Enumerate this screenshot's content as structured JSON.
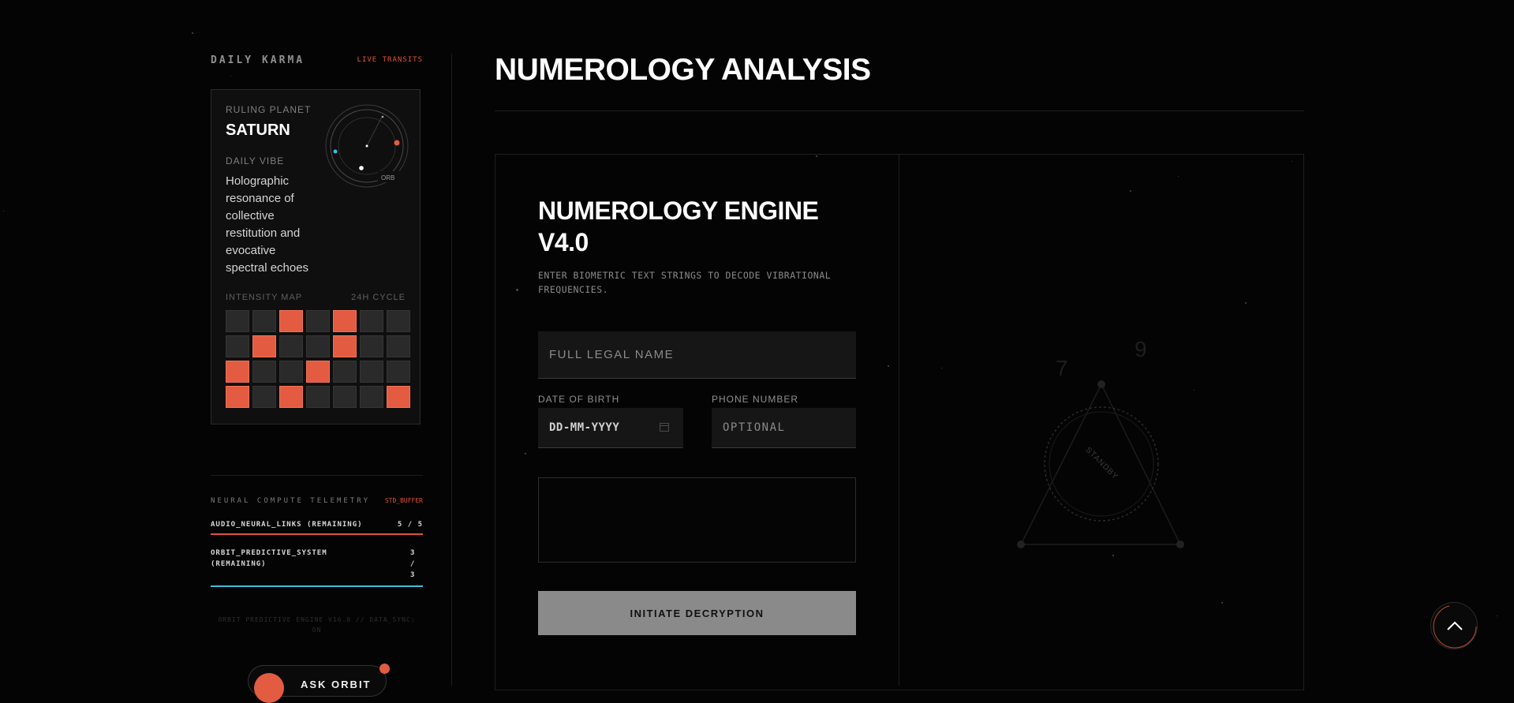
{
  "sidebar": {
    "title": "DAILY KARMA",
    "live_label": "LIVE TRANSITS",
    "card": {
      "ruling_planet_label": "RULING PLANET",
      "ruling_planet": "SATURN",
      "daily_vibe_label": "DAILY VIBE",
      "daily_vibe": "Holographic resonance of collective restitution and evocative spectral echoes",
      "orbit_tag": "ORB",
      "intensity_label": "INTENSITY MAP",
      "cycle_label": "24H CYCLE",
      "intensity_grid": [
        [
          0,
          0,
          1,
          0,
          1,
          0,
          0
        ],
        [
          0,
          1,
          0,
          0,
          1,
          0,
          0
        ],
        [
          1,
          0,
          0,
          1,
          0,
          0,
          0
        ],
        [
          1,
          0,
          1,
          0,
          0,
          0,
          1
        ]
      ]
    },
    "telemetry": {
      "title": "NEURAL COMPUTE TELEMETRY",
      "buffer_label": "STD_BUFFER",
      "rows": [
        {
          "key": "AUDIO_NEURAL_LINKS (REMAINING)",
          "value": "5 / 5"
        },
        {
          "key": "ORBIT_PREDICTIVE_SYSTEM (REMAINING)",
          "value": "3 / 3"
        }
      ]
    },
    "footer_note": "ORBIT PREDICTIVE ENGINE V16.0 // DATA_SYNC: ON",
    "ask_button": "ASK ORBIT"
  },
  "main": {
    "title": "NUMEROLOGY ANALYSIS",
    "engine": {
      "title": "NUMEROLOGY ENGINE V4.0",
      "subtitle": "ENTER BIOMETRIC TEXT STRINGS TO DECODE VIBRATIONAL FREQUENCIES.",
      "name_placeholder": "FULL LEGAL NAME",
      "dob_label": "DATE OF BIRTH",
      "dob_placeholder": "DD-MM-YYYY",
      "phone_label": "PHONE NUMBER",
      "phone_placeholder": "OPTIONAL",
      "submit_label": "INITIATE DECRYPTION"
    },
    "visual": {
      "standby_label": "STANDBY",
      "numerals": [
        "7",
        "9"
      ]
    }
  },
  "colors": {
    "accent": "#e35b40",
    "cyan": "#3cc0d8",
    "background": "#040404"
  },
  "icons": [
    "orbit-icon",
    "calendar-icon",
    "chevron-up-icon"
  ]
}
